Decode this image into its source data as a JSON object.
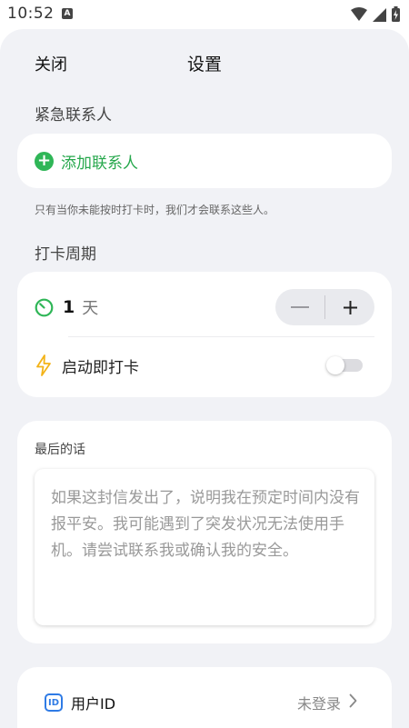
{
  "status_bar": {
    "time": "10:52",
    "notification_icon": "A",
    "icons": [
      "wifi-icon",
      "signal-icon",
      "battery-charging-icon"
    ]
  },
  "nav": {
    "close_label": "关闭",
    "title": "设置"
  },
  "emergency": {
    "section_label": "紧急联系人",
    "add_label": "添加联系人",
    "hint": "只有当你未能按时打卡时，我们才会联系这些人。"
  },
  "checkin": {
    "section_label": "打卡周期",
    "days_value": "1",
    "days_unit": "天",
    "decrement_label": "—",
    "increment_label": "+",
    "start_label": "启动即打卡",
    "start_enabled": false
  },
  "last_words": {
    "label": "最后的话",
    "placeholder": "如果这封信发出了，说明我在预定时间内没有报平安。我可能遇到了突发状况无法使用手机。请尝试联系我或确认我的安全。"
  },
  "account": {
    "user_id_label": "用户ID",
    "status": "未登录"
  },
  "colors": {
    "accent_green": "#2fb657",
    "warning_yellow": "#f3b318",
    "accent_blue": "#2f7be5",
    "background": "#f1f2f6"
  }
}
